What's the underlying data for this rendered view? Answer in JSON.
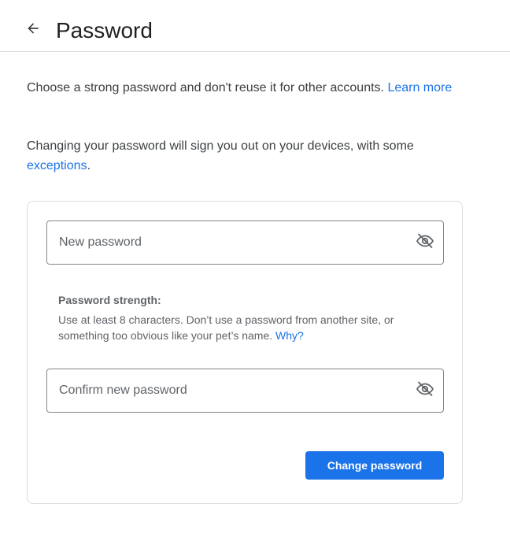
{
  "header": {
    "title": "Password",
    "back_icon": "arrow-back-icon"
  },
  "intro": {
    "line1_text": "Choose a strong password and don't reuse it for other accounts. ",
    "line1_link": "Learn more",
    "line2_text": "Changing your password will sign you out on your devices, with some ",
    "line2_link": "exceptions",
    "line2_suffix": "."
  },
  "form": {
    "new_password": {
      "placeholder": "New password",
      "value": "",
      "toggle_icon": "visibility-off-icon"
    },
    "strength": {
      "title": "Password strength:",
      "description": "Use at least 8 characters. Don’t use a password from another site, or something too obvious like your pet’s name. ",
      "link": "Why?"
    },
    "confirm_password": {
      "placeholder": "Confirm new password",
      "value": "",
      "toggle_icon": "visibility-off-icon"
    },
    "submit_label": "Change password"
  },
  "colors": {
    "accent": "#1a73e8",
    "text_primary": "#202124",
    "text_secondary": "#5f6368",
    "border": "#dadce0",
    "field_border": "#80868b"
  }
}
